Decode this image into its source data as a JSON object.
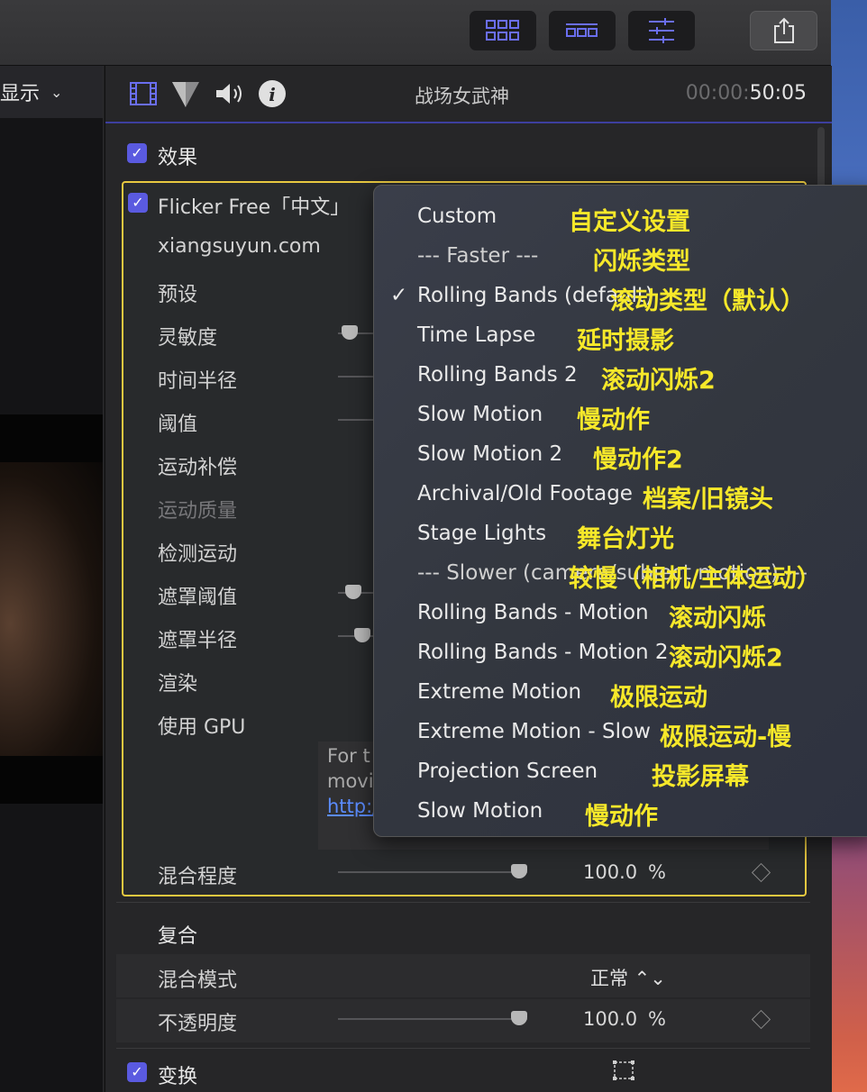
{
  "toolbar": {
    "buttons": [
      "grid-view-icon",
      "filmstrip-icon",
      "inspector-sliders-icon"
    ],
    "share_icon": "share-icon"
  },
  "viewer": {
    "label": "显示",
    "chevron": "⌄"
  },
  "inspector": {
    "tabs": [
      "video-icon",
      "color-icon",
      "audio-icon",
      "info-icon"
    ],
    "clip_title": "战场女武神",
    "timecode_dim": "00:00:",
    "timecode_main": "50:05",
    "effects_label": "效果",
    "effect": {
      "name": "Flicker Free「中文」",
      "params": [
        {
          "label": "xiangsuyun.com"
        },
        {
          "label": "预设"
        },
        {
          "label": "灵敏度"
        },
        {
          "label": "时间半径"
        },
        {
          "label": "阈值"
        },
        {
          "label": "运动补偿"
        },
        {
          "label": "运动质量"
        },
        {
          "label": "检测运动"
        },
        {
          "label": "遮罩阈值"
        },
        {
          "label": "遮罩半径"
        },
        {
          "label": "渲染"
        },
        {
          "label": "使用 GPU"
        }
      ],
      "info_text": "For t\nmovi",
      "info_link": "http:/",
      "mix_label": "混合程度",
      "mix_value": "100.0",
      "mix_unit": "%"
    },
    "composite": {
      "label": "复合",
      "blend_mode_label": "混合模式",
      "blend_mode_value": "正常 ⌃⌄",
      "opacity_label": "不透明度",
      "opacity_value": "100.0",
      "opacity_unit": "%"
    },
    "transform_label": "变换"
  },
  "menu": {
    "items": [
      {
        "label": "Custom",
        "cn": "自定义设置"
      },
      {
        "label": "--- Faster ---",
        "cn": "闪烁类型"
      },
      {
        "label": "Rolling Bands (default)",
        "cn": "滚动类型（默认）",
        "checked": true
      },
      {
        "label": "Time Lapse",
        "cn": "延时摄影"
      },
      {
        "label": "Rolling Bands 2",
        "cn": "滚动闪烁2"
      },
      {
        "label": "Slow Motion",
        "cn": "慢动作"
      },
      {
        "label": "Slow Motion 2",
        "cn": "慢动作2"
      },
      {
        "label": "Archival/Old Footage",
        "cn": "档案/旧镜头"
      },
      {
        "label": "Stage Lights",
        "cn": "舞台灯光"
      },
      {
        "label": "--- Slower (camera/subject motion) ---",
        "cn": "较慢（相机/主体运动）"
      },
      {
        "label": "Rolling Bands - Motion",
        "cn": "滚动闪烁"
      },
      {
        "label": "Rolling Bands - Motion 2",
        "cn": "滚动闪烁2"
      },
      {
        "label": "Extreme Motion",
        "cn": "极限运动"
      },
      {
        "label": "Extreme Motion - Slow",
        "cn": "极限运动-慢"
      },
      {
        "label": "Projection Screen",
        "cn": "投影屏幕"
      },
      {
        "label": "Slow Motion",
        "cn": "慢动作"
      }
    ],
    "check_glyph": "✓"
  }
}
